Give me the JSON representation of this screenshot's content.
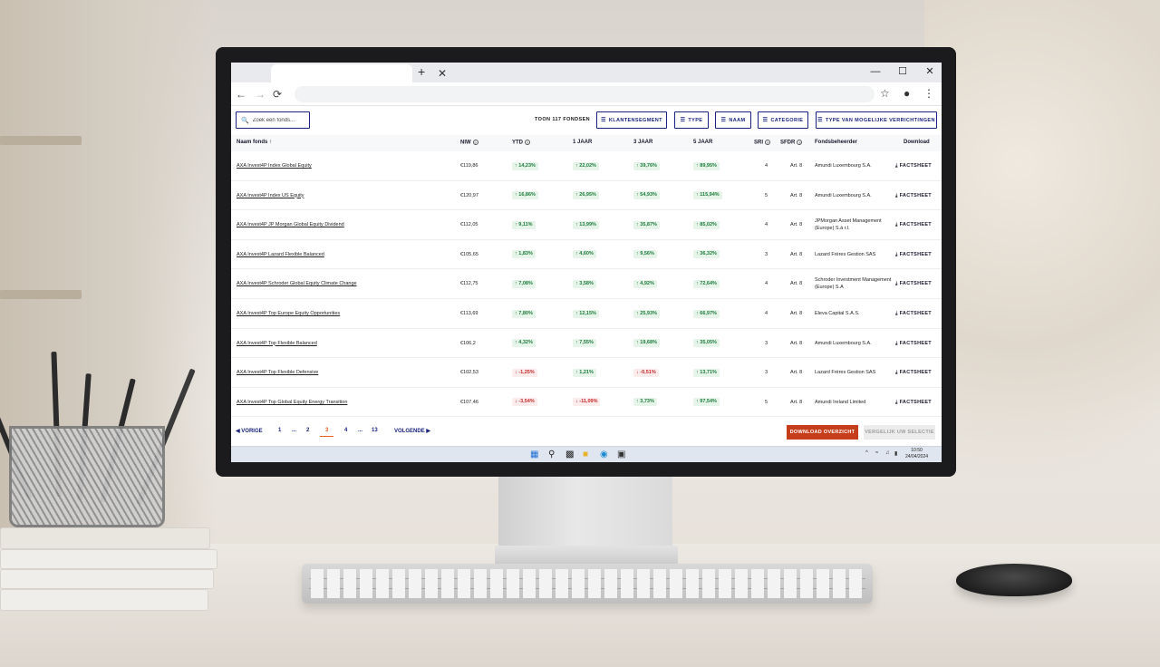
{
  "browser": {
    "tab_close": "✕",
    "tab_new": "+",
    "win_min": "—",
    "win_max": "☐",
    "win_close": "✕",
    "nav_back": "←",
    "nav_forward": "→",
    "nav_reload": "⟳",
    "star": "☆",
    "profile": "●",
    "menu": "⋮"
  },
  "toolbar": {
    "search_placeholder": "Zoek een fonds...",
    "count_label": "TOON 117 FONDSEN",
    "filters": [
      {
        "label": "KLANTENSEGMENT"
      },
      {
        "label": "TYPE"
      },
      {
        "label": "NAAM"
      },
      {
        "label": "CATEGORIE"
      },
      {
        "label": "TYPE VAN MOGELIJKE VERRICHTINGEN"
      }
    ]
  },
  "table": {
    "headers": {
      "name": "Naam fonds",
      "sort": "↑",
      "niw": "NIW",
      "ytd": "YTD",
      "y1": "1 JAAR",
      "y3": "3 JAAR",
      "y5": "5 JAAR",
      "sri": "SRI",
      "sfdr": "SFDR",
      "manager": "Fondsbeheerder",
      "download": "Download"
    },
    "rows": [
      {
        "name": "AXA Invest4P Index Global Equity",
        "niw": "€119,86",
        "ytd": "14,23%",
        "y1": "22,02%",
        "y3": "39,76%",
        "y5": "89,95%",
        "sri": "4",
        "sfdr": "Art. 8",
        "manager": "Amundi Luxembourg S.A."
      },
      {
        "name": "AXA Invest4P Index US Equity",
        "niw": "€120,97",
        "ytd": "16,86%",
        "y1": "26,95%",
        "y3": "54,93%",
        "y5": "115,94%",
        "sri": "5",
        "sfdr": "Art. 8",
        "manager": "Amundi Luxembourg S.A."
      },
      {
        "name": "AXA Invest4P JP Morgan Global Equity Dividend",
        "niw": "€112,05",
        "ytd": "9,11%",
        "y1": "13,99%",
        "y3": "35,87%",
        "y5": "85,02%",
        "sri": "4",
        "sfdr": "Art. 8",
        "manager": "JPMorgan Asset Management (Europe) S.à r.l."
      },
      {
        "name": "AXA Invest4P Lazard Flexible Balanced",
        "niw": "€105,65",
        "ytd": "1,83%",
        "y1": "4,60%",
        "y3": "9,56%",
        "y5": "36,32%",
        "sri": "3",
        "sfdr": "Art. 8",
        "manager": "Lazard Frères Gestion SAS"
      },
      {
        "name": "AXA Invest4P Schroder Global Equity Climate Change",
        "niw": "€112,75",
        "ytd": "7,08%",
        "y1": "3,58%",
        "y3": "4,92%",
        "y5": "72,64%",
        "sri": "4",
        "sfdr": "Art. 8",
        "manager": "Schroder Investment Management (Europe) S.A"
      },
      {
        "name": "AXA Invest4P Top Europe Equity Opportunities",
        "niw": "€113,69",
        "ytd": "7,80%",
        "y1": "12,15%",
        "y3": "25,93%",
        "y5": "66,97%",
        "sri": "4",
        "sfdr": "Art. 8",
        "manager": "Eleva Capital S.A.S."
      },
      {
        "name": "AXA Invest4P Top Flexible Balanced",
        "niw": "€106,2",
        "ytd": "4,32%",
        "y1": "7,55%",
        "y3": "19,68%",
        "y5": "35,05%",
        "sri": "3",
        "sfdr": "Art. 8",
        "manager": "Amundi Luxembourg S.A."
      },
      {
        "name": "AXA Invest4P Top Flexible Defensive",
        "niw": "€102,53",
        "ytd": "-1,25%",
        "y1": "1,21%",
        "y3": "-0,51%",
        "y5": "13,71%",
        "sri": "3",
        "sfdr": "Art. 8",
        "manager": "Lazard Frères Gestion SAS"
      },
      {
        "name": "AXA Invest4P Top Global Equity Energy Transition",
        "niw": "€107,46",
        "ytd": "-3,54%",
        "y1": "-11,09%",
        "y3": "3,73%",
        "y5": "97,54%",
        "sri": "5",
        "sfdr": "Art. 8",
        "manager": "Amundi Ireland Limited"
      }
    ],
    "download_label": "FACTSHEET"
  },
  "pager": {
    "prev": "VORIGE",
    "pages": [
      "1",
      "...",
      "2",
      "3",
      "4",
      "...",
      "13"
    ],
    "current": "3",
    "next": "VOLGENDE"
  },
  "actions": {
    "download_overview": "DOWNLOAD OVERZICHT",
    "compare": "VERGELIJK UW SELECTIE"
  },
  "taskbar": {
    "time": "10:50",
    "date": "24/04/2024"
  },
  "colors": {
    "accent": "#1a237e",
    "primary_button": "#c63d1b",
    "positive": "#1e7b3a",
    "negative": "#c62828"
  }
}
